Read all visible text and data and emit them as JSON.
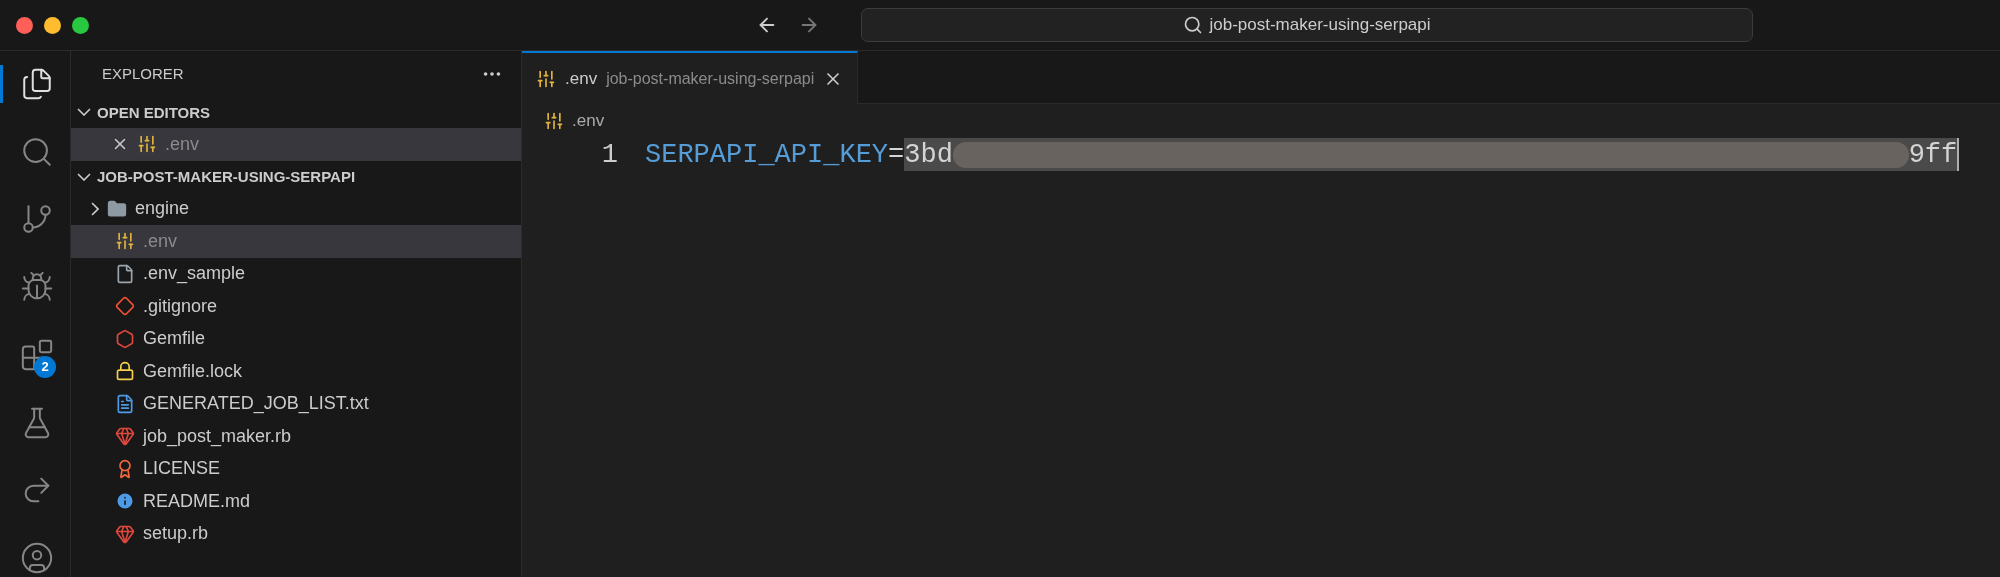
{
  "title_bar": {
    "command_center": "job-post-maker-using-serpapi"
  },
  "activity_bar": [
    {
      "kind": "files",
      "selected": true
    },
    {
      "kind": "search",
      "selected": false
    },
    {
      "kind": "branch",
      "selected": false
    },
    {
      "kind": "debug",
      "selected": false
    },
    {
      "kind": "extensions",
      "selected": false,
      "badge": "2"
    },
    {
      "kind": "flask",
      "selected": false
    },
    {
      "kind": "share",
      "selected": false
    },
    {
      "kind": "account",
      "selected": false
    }
  ],
  "sidebar": {
    "title": "EXPLORER",
    "sections": [
      {
        "title": "OPEN EDITORS",
        "expanded": true,
        "items": [
          {
            "name": ".env",
            "kind": "env",
            "selected": true,
            "closable": true
          }
        ]
      },
      {
        "title": "JOB-POST-MAKER-USING-SERPAPI",
        "expanded": true,
        "items": [
          {
            "name": "engine",
            "kind": "folder",
            "expanded": false,
            "selected": false
          },
          {
            "name": ".env",
            "kind": "env",
            "selected": true
          },
          {
            "name": ".env_sample",
            "kind": "file",
            "selected": false
          },
          {
            "name": ".gitignore",
            "kind": "git",
            "selected": false
          },
          {
            "name": "Gemfile",
            "kind": "gem",
            "selected": false
          },
          {
            "name": "Gemfile.lock",
            "kind": "lock",
            "selected": false
          },
          {
            "name": "GENERATED_JOB_LIST.txt",
            "kind": "text",
            "selected": false
          },
          {
            "name": "job_post_maker.rb",
            "kind": "ruby",
            "selected": false
          },
          {
            "name": "LICENSE",
            "kind": "license",
            "selected": false
          },
          {
            "name": "README.md",
            "kind": "info",
            "selected": false
          },
          {
            "name": "setup.rb",
            "kind": "ruby",
            "selected": false
          }
        ]
      }
    ]
  },
  "editor": {
    "tabs": [
      {
        "label": ".env",
        "description": "job-post-maker-using-serpapi",
        "kind": "env",
        "selected": true
      }
    ],
    "breadcrumb": {
      "label": ".env",
      "kind": "env"
    },
    "lines": [
      {
        "number": "1",
        "key": "SERPAPI_API_KEY",
        "operator": "=",
        "value_start": "3bd",
        "value_end": "9ff"
      }
    ]
  }
}
